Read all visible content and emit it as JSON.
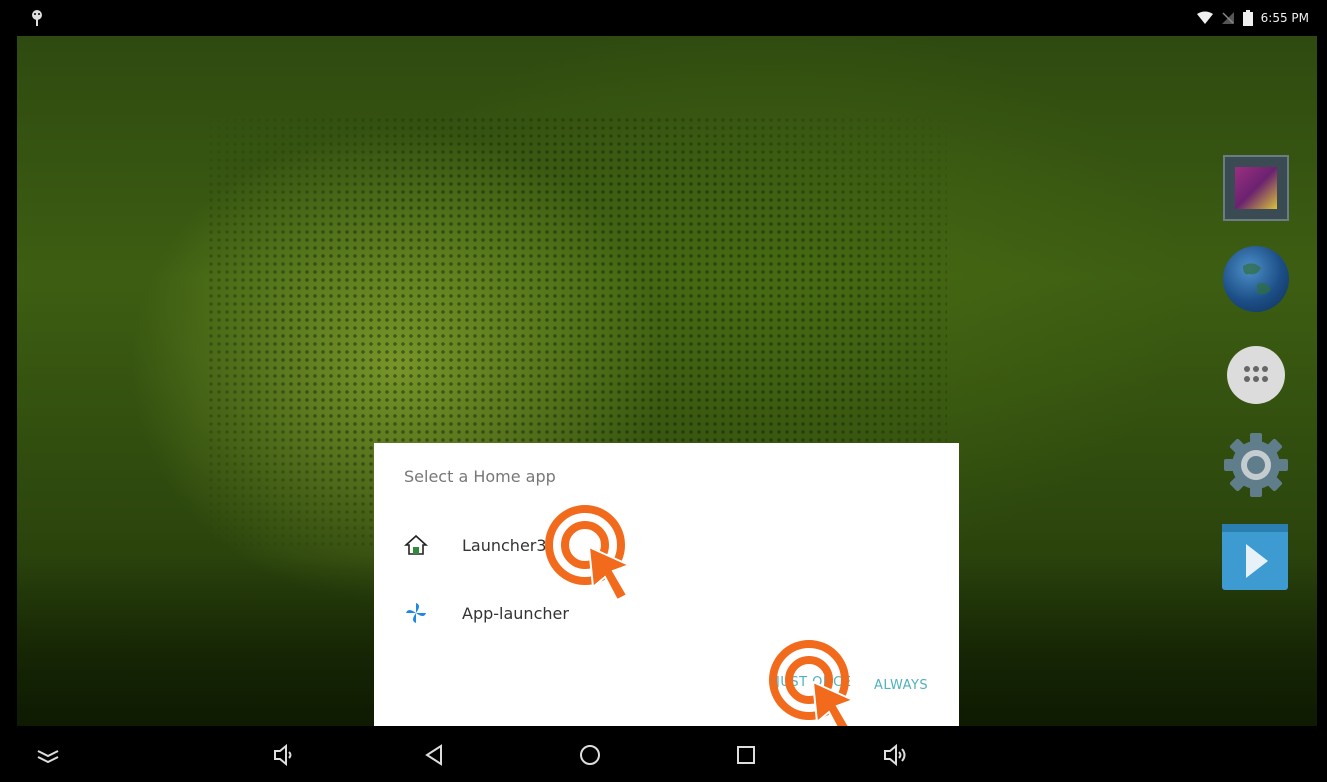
{
  "status_bar": {
    "time": "6:55 PM",
    "icons": [
      "android-debug-icon",
      "wifi-icon",
      "no-signal-icon",
      "battery-icon"
    ]
  },
  "dock": {
    "items": [
      "gallery-icon",
      "browser-icon",
      "all-apps-icon",
      "settings-icon",
      "play-store-icon"
    ]
  },
  "dialog": {
    "title": "Select a Home app",
    "options": [
      {
        "label": "Launcher3",
        "icon": "home-icon"
      },
      {
        "label": "App-launcher",
        "icon": "pinwheel-icon"
      }
    ],
    "buttons": {
      "just_once": "JUST ONCE",
      "always": "ALWAYS"
    },
    "accent_color": "#4fb1bf"
  },
  "nav_bar": {
    "buttons": [
      "hide-nav-icon",
      "volume-down-icon",
      "back-icon",
      "home-icon",
      "recents-icon",
      "volume-up-icon"
    ]
  },
  "tap_indicator_color": "#f26a1b"
}
